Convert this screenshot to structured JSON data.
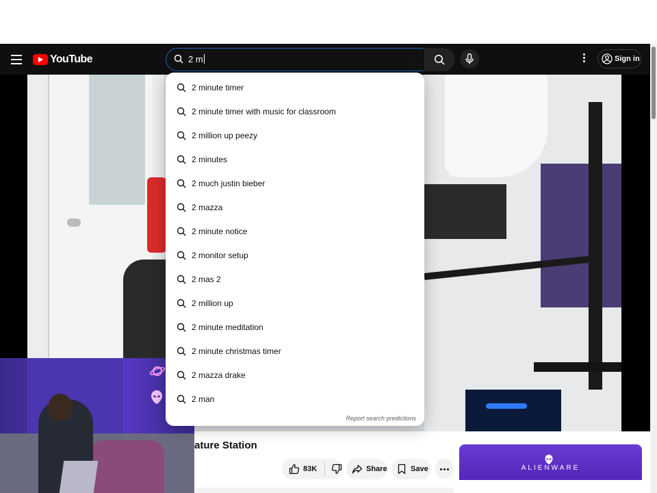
{
  "header": {
    "logo_text": "YouTube",
    "search_value": "2 m",
    "signin_label": "Sign in"
  },
  "suggestions": [
    "2 minute timer",
    "2 minute timer with music for classroom",
    "2 million up peezy",
    "2 minutes",
    "2 much justin bieber",
    "2 mazza",
    "2 minute notice",
    "2 monitor setup",
    "2 mas 2",
    "2 million up",
    "2 minute meditation",
    "2 minute christmas timer",
    "2 mazza drake",
    "2 man"
  ],
  "report_label": "Report search predictions",
  "video": {
    "title_fragment": "ature Station",
    "like_count": "83K",
    "share_label": "Share",
    "save_label": "Save"
  },
  "ad": {
    "brand": "ALIENWARE"
  },
  "colors": {
    "header_bg": "#0f0f0f",
    "logo_red": "#ff0000",
    "search_focus_border": "#1c62b9",
    "ad_purple": "#5a2bc2"
  },
  "icons": {
    "menu": "hamburger-icon",
    "search": "search-icon",
    "mic": "microphone-icon",
    "more": "more-vertical-icon",
    "account": "account-circle-icon",
    "like": "thumbs-up-icon",
    "dislike": "thumbs-down-icon",
    "share": "share-arrow-icon",
    "save": "bookmark-icon"
  }
}
